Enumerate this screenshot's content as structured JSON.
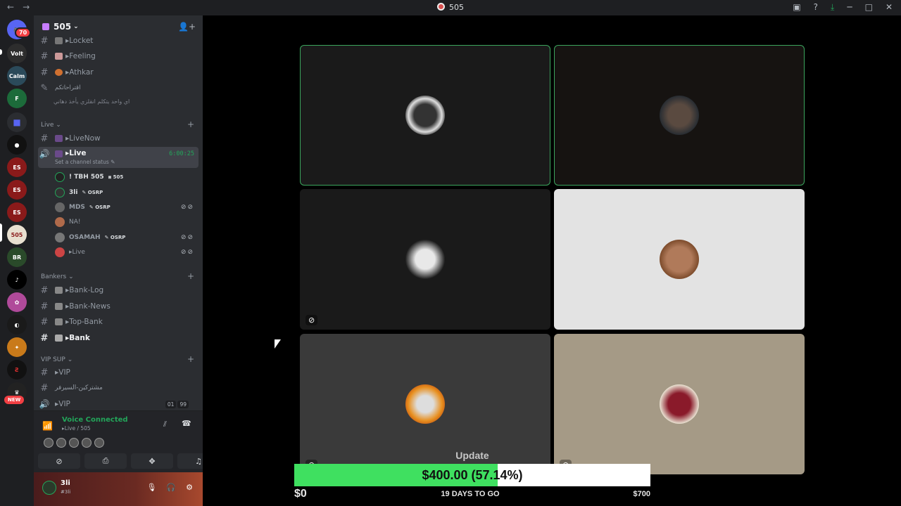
{
  "window": {
    "title": "505",
    "controls": [
      "cast-icon",
      "help-icon",
      "download-icon",
      "minimize-icon",
      "maximize-icon",
      "close-icon"
    ]
  },
  "rail": {
    "mention_badge": "70",
    "new_badge": "NEW",
    "servers": [
      "Volt",
      "Calm",
      "Fate",
      "folder",
      "shadow",
      "ES",
      "ES",
      "ES",
      "505",
      "BR",
      "tiktok",
      "pink",
      "dark",
      "flame",
      "VP",
      "crown"
    ]
  },
  "server": {
    "name": "505",
    "caret": "⌄"
  },
  "channels": {
    "top": [
      {
        "type": "text",
        "name": "▸Locket"
      },
      {
        "type": "text",
        "name": "▸Feeling"
      },
      {
        "type": "text",
        "name": "▸Athkar"
      }
    ],
    "thread_title": "اقتراحاتكم",
    "thread_sub": "اي واحد يتكلم انقلزي يأخذ دهاني",
    "live_category": "Live",
    "live_channels": [
      {
        "type": "text",
        "name": "▸LiveNow"
      }
    ],
    "voice_live": {
      "name": "▸Live",
      "timer": "6:00:25",
      "status": "Set a channel status"
    },
    "voice_users": [
      {
        "name": "! TBH 505",
        "tag": "505",
        "talking": true,
        "muted": false
      },
      {
        "name": "3li",
        "tag": "OSRP",
        "talking": true,
        "muted": false
      },
      {
        "name": "MDS",
        "tag": "OSRP",
        "talking": false,
        "muted": true
      },
      {
        "name": "NA!",
        "tag": "",
        "talking": false,
        "muted": false
      },
      {
        "name": "OSAMAH",
        "tag": "OSRP",
        "talking": false,
        "muted": true
      },
      {
        "name": "▸Live",
        "tag": "",
        "talking": false,
        "muted": true
      }
    ],
    "bankers_category": "Bankers",
    "bankers": [
      {
        "name": "▸Bank-Log",
        "bold": false
      },
      {
        "name": "▸Bank-News",
        "bold": false
      },
      {
        "name": "▸Top-Bank",
        "bold": false
      },
      {
        "name": "▸Bank",
        "bold": true
      }
    ],
    "vip_category": "VIP SUP",
    "vip": [
      {
        "type": "text",
        "name": "▸VIP"
      },
      {
        "type": "text",
        "name": "مشتركين-السيرفر"
      }
    ],
    "vip_voice": {
      "name": "▸VIP",
      "count_a": "01",
      "count_b": "99"
    }
  },
  "voice_panel": {
    "title": "Voice Connected",
    "subtitle": "▸Live / 505"
  },
  "user_panel": {
    "name": "3li",
    "tag": "#3li"
  },
  "stage": {
    "tiles": [
      {
        "speaking": true,
        "bg": "#1a1a1a",
        "icon": ""
      },
      {
        "speaking": true,
        "bg": "#161311",
        "icon": ""
      },
      {
        "speaking": false,
        "bg": "#1a1a1a",
        "icon": "⊘"
      },
      {
        "speaking": false,
        "bg": "#e3e3e3",
        "icon": ""
      },
      {
        "speaking": false,
        "bg": "#3a3a3a",
        "icon": "⊘"
      },
      {
        "speaking": false,
        "bg": "#a59a86",
        "icon": "⊘"
      }
    ]
  },
  "donation": {
    "update_label": "Update",
    "amount_text": "$400.00 (57.14%)",
    "progress_fraction": 0.5714,
    "min_label": "$0",
    "days_label": "19 DAYS TO GO",
    "max_label": "$700",
    "bar_color": "#3fe060"
  }
}
